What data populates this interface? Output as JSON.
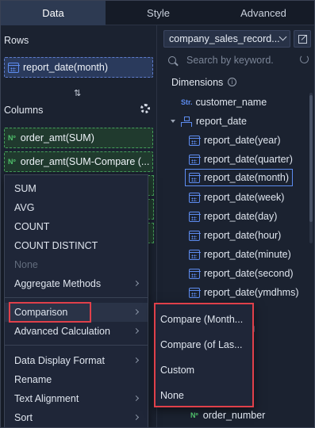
{
  "tabs": [
    "Data",
    "Style",
    "Advanced"
  ],
  "left_panel": {
    "rows_title": "Rows",
    "row_field": "report_date(month)",
    "columns_title": "Columns",
    "column_fields": [
      "order_amt(SUM)",
      "order_amt(SUM-Compare (..."
    ],
    "measure_tag": "Nº"
  },
  "right_panel": {
    "dataset": "company_sales_record...",
    "search_placeholder": "Search by keyword.",
    "dimensions_title": "Dimensions",
    "info_glyph": "i",
    "string_tag": "Str.",
    "customer_field": "customer_name",
    "date_group": "report_date",
    "date_fields": [
      "report_date(year)",
      "report_date(quarter)",
      "report_date(month)",
      "report_date(week)",
      "report_date(day)",
      "report_date(hour)",
      "report_date(minute)",
      "report_date(second)",
      "report_date(ymdhms)"
    ],
    "selected_date_field": "report_date(month)",
    "measure_field": "order_number",
    "measure_tag": "Nº"
  },
  "aggregate_menu": {
    "items": [
      "SUM",
      "AVG",
      "COUNT",
      "COUNT DISTINCT",
      "None",
      "Aggregate Methods"
    ],
    "comparison": "Comparison",
    "advanced_calculation": "Advanced Calculation",
    "format_items": [
      "Data Display Format",
      "Rename",
      "Text Alignment",
      "Sort"
    ]
  },
  "comparison_submenu": {
    "items": [
      "Compare (Month...",
      "Compare (of Las...",
      "Custom",
      "None"
    ]
  },
  "colors": {
    "accent_blue": "#5d8cf0",
    "measure_green": "#4fbf6a",
    "highlight_red": "#e0404a"
  }
}
